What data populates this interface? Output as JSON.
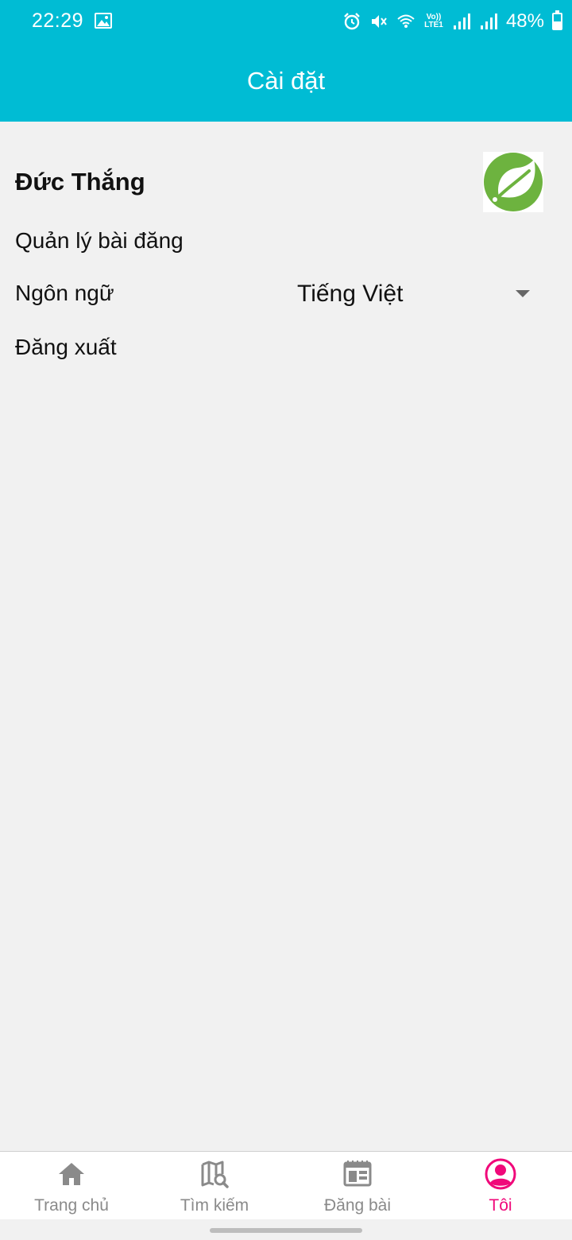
{
  "status_bar": {
    "time": "22:29",
    "lte_top": "Vo))",
    "lte_bottom": "LTE1",
    "battery_percent": "48%",
    "battery_level": 0.48
  },
  "app_bar": {
    "title": "Cài đặt"
  },
  "profile": {
    "name": "Đức Thắng",
    "avatar_icon": "spring-leaf-logo-icon"
  },
  "menu": {
    "manage_posts": "Quản lý bài đăng",
    "language_label": "Ngôn ngữ",
    "language_value": "Tiếng Việt",
    "logout": "Đăng xuất"
  },
  "bottom_nav": {
    "items": [
      {
        "label": "Trang chủ",
        "icon": "home-icon",
        "active": false
      },
      {
        "label": "Tìm kiếm",
        "icon": "map-search-icon",
        "active": false
      },
      {
        "label": "Đăng bài",
        "icon": "post-article-icon",
        "active": false
      },
      {
        "label": "Tôi",
        "icon": "account-circle-icon",
        "active": true
      }
    ]
  },
  "colors": {
    "primary": "#00bcd4",
    "active_tab": "#f0087a",
    "inactive_tab": "#8a8a8a",
    "background": "#f1f1f1",
    "leaf_green": "#6db33f"
  }
}
